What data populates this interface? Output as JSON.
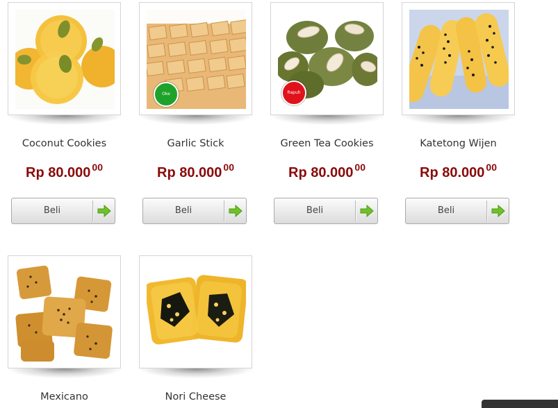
{
  "products": [
    {
      "name": "Coconut Cookies",
      "price": "Rp 80.000",
      "cents": "00",
      "buy_label": "Beli",
      "badge": ""
    },
    {
      "name": "Garlic Stick",
      "price": "Rp 80.000",
      "cents": "00",
      "buy_label": "Beli",
      "badge": "Oke",
      "badge_color": "#1fa22a"
    },
    {
      "name": "Green Tea Cookies",
      "price": "Rp 80.000",
      "cents": "00",
      "buy_label": "Beli",
      "badge": "Rapuh",
      "badge_color": "#e0121b"
    },
    {
      "name": "Katetong Wijen",
      "price": "Rp 80.000",
      "cents": "00",
      "buy_label": "Beli",
      "badge": ""
    },
    {
      "name": "Mexicano",
      "badge": ""
    },
    {
      "name": "Nori Cheese",
      "badge": ""
    }
  ],
  "colors": {
    "price": "#8a0a0a",
    "arrow": "#6fc12a",
    "badge_ok": "#1fa22a",
    "badge_rapuh": "#e0121b"
  },
  "icons": {
    "buy_arrow": "arrow-right-icon"
  }
}
